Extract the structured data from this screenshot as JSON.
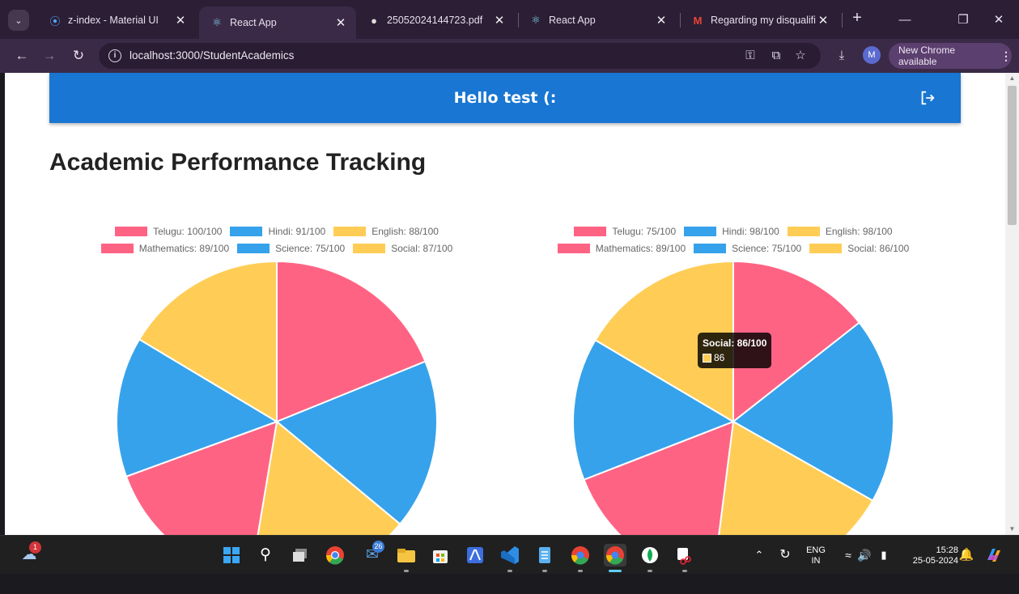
{
  "browser": {
    "tabs": [
      {
        "title": "z-index - Material UI",
        "favicon": "material-ui-icon",
        "active": false
      },
      {
        "title": "React App",
        "favicon": "react-icon",
        "active": true
      },
      {
        "title": "25052024144723.pdf",
        "favicon": "globe-icon",
        "active": false
      },
      {
        "title": "React App",
        "favicon": "react-icon",
        "active": false
      },
      {
        "title": "Regarding my disqualific",
        "favicon": "gmail-icon",
        "active": false
      }
    ],
    "url": "localhost:3000/StudentAcademics",
    "update_chip": "New Chrome available",
    "profile_initial": "M"
  },
  "app": {
    "header_title": "Hello test (:",
    "page_title": "Academic Performance Tracking"
  },
  "charts": {
    "colors": {
      "pink": "#ff6384",
      "blue": "#36a2eb",
      "yellow": "#ffcd56"
    },
    "tooltip": {
      "title": "Social: 86/100",
      "value": "86"
    }
  },
  "chart_data": [
    {
      "type": "pie",
      "legend_position": "top",
      "labels": [
        "Telugu: 100/100",
        "Hindi: 91/100",
        "English: 88/100",
        "Mathematics: 89/100",
        "Science: 75/100",
        "Social: 87/100"
      ],
      "values": [
        100,
        91,
        88,
        89,
        75,
        87
      ],
      "colors": [
        "#ff6384",
        "#36a2eb",
        "#ffcd56",
        "#ff6384",
        "#36a2eb",
        "#ffcd56"
      ]
    },
    {
      "type": "pie",
      "legend_position": "top",
      "labels": [
        "Telugu: 75/100",
        "Hindi: 98/100",
        "English: 98/100",
        "Mathematics: 89/100",
        "Science: 75/100",
        "Social: 86/100"
      ],
      "values": [
        75,
        98,
        98,
        89,
        75,
        86
      ],
      "colors": [
        "#ff6384",
        "#36a2eb",
        "#ffcd56",
        "#ff6384",
        "#36a2eb",
        "#ffcd56"
      ]
    }
  ],
  "taskbar": {
    "weather_badge": "1",
    "mail_badge": "26",
    "language": "ENG",
    "region": "IN",
    "time": "15:28",
    "date": "25-05-2024"
  }
}
